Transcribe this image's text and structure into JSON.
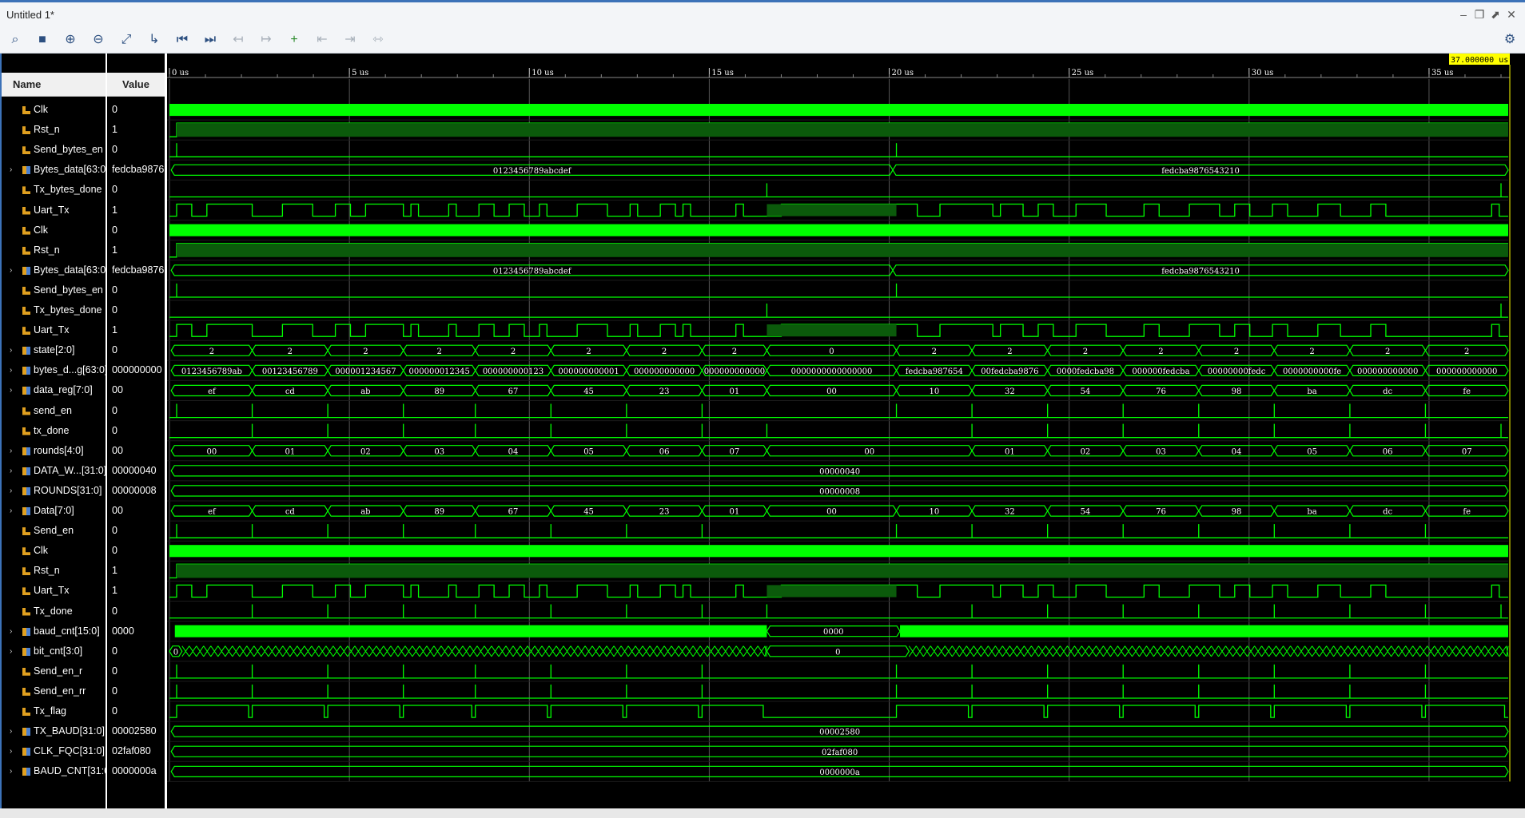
{
  "window": {
    "title": "Untitled 1*"
  },
  "toolbar": {
    "items": [
      "search-icon",
      "save-icon",
      "zoom-in-icon",
      "zoom-out-icon",
      "zoom-fit-icon",
      "go-to-cursor-icon",
      "go-to-start-icon",
      "go-to-end-icon",
      "previous-transition-icon",
      "next-transition-icon",
      "add-marker-icon",
      "previous-marker-icon",
      "next-marker-icon",
      "swap-cursors-icon",
      "settings-icon"
    ]
  },
  "columns": {
    "name": "Name",
    "value": "Value"
  },
  "cursor": {
    "label": "37.000000 us",
    "time": 37
  },
  "timeline": {
    "end": 37.2,
    "ticks": [
      {
        "t": 0,
        "label": "0 us"
      },
      {
        "t": 5,
        "label": "5 us"
      },
      {
        "t": 10,
        "label": "10 us"
      },
      {
        "t": 15,
        "label": "15 us"
      },
      {
        "t": 20,
        "label": "20 us"
      },
      {
        "t": 25,
        "label": "25 us"
      },
      {
        "t": 30,
        "label": "30 us"
      },
      {
        "t": 35,
        "label": "35 us"
      }
    ]
  },
  "colors": {
    "wave": "#00ff00",
    "background": "#000000",
    "cursor_label": "#ffff00",
    "grid": "#444444"
  },
  "signals": [
    {
      "name": "Clk",
      "value": "0",
      "kind": "clock",
      "expandable": false
    },
    {
      "name": "Rst_n",
      "value": "1",
      "kind": "high",
      "expandable": false
    },
    {
      "name": "Send_bytes_en",
      "value": "0",
      "kind": "pulses",
      "expandable": false
    },
    {
      "name": "Bytes_data[63:0]",
      "value": "fedcba9876",
      "kind": "bus",
      "expandable": true,
      "segs": [
        "0123456789abcdef",
        "fedcba9876543210"
      ]
    },
    {
      "name": "Tx_bytes_done",
      "value": "0",
      "kind": "pulse_done",
      "expandable": false
    },
    {
      "name": "Uart_Tx",
      "value": "1",
      "kind": "uart",
      "expandable": false
    },
    {
      "name": "Clk",
      "value": "0",
      "kind": "clock",
      "expandable": false
    },
    {
      "name": "Rst_n",
      "value": "1",
      "kind": "high",
      "expandable": false
    },
    {
      "name": "Bytes_data[63:0]",
      "value": "fedcba9876",
      "kind": "bus",
      "expandable": true,
      "segs": [
        "0123456789abcdef",
        "fedcba9876543210"
      ]
    },
    {
      "name": "Send_bytes_en",
      "value": "0",
      "kind": "pulses",
      "expandable": false
    },
    {
      "name": "Tx_bytes_done",
      "value": "0",
      "kind": "pulse_done",
      "expandable": false
    },
    {
      "name": "Uart_Tx",
      "value": "1",
      "kind": "uart",
      "expandable": false
    },
    {
      "name": "state[2:0]",
      "value": "0",
      "kind": "bus16",
      "expandable": true,
      "segs": [
        "2",
        "2",
        "2",
        "2",
        "2",
        "2",
        "2",
        "2",
        "0",
        "2",
        "2",
        "2",
        "2",
        "2",
        "2",
        "2",
        "2"
      ]
    },
    {
      "name": "bytes_d...g[63:0]",
      "value": "000000000",
      "kind": "bus16",
      "expandable": true,
      "segs": [
        "0123456789ab",
        "00123456789",
        "000001234567",
        "000000012345",
        "000000000123",
        "000000000001",
        "000000000000",
        "000000000000",
        "0000000000000000",
        "fedcba987654",
        "00fedcba9876",
        "0000fedcba98",
        "000000fedcba",
        "00000000fedc",
        "0000000000fe",
        "000000000000",
        "000000000000"
      ]
    },
    {
      "name": "data_reg[7:0]",
      "value": "00",
      "kind": "bus16",
      "expandable": true,
      "segs": [
        "ef",
        "cd",
        "ab",
        "89",
        "67",
        "45",
        "23",
        "01",
        "00",
        "10",
        "32",
        "54",
        "76",
        "98",
        "ba",
        "dc",
        "fe"
      ]
    },
    {
      "name": "send_en",
      "value": "0",
      "kind": "pulse_byte_start",
      "expandable": false
    },
    {
      "name": "tx_done",
      "value": "0",
      "kind": "pulse_byte_end",
      "expandable": false
    },
    {
      "name": "rounds[4:0]",
      "value": "00",
      "kind": "bus16",
      "expandable": true,
      "segs": [
        "00",
        "01",
        "02",
        "03",
        "04",
        "05",
        "06",
        "07",
        "00",
        "01",
        "02",
        "03",
        "04",
        "05",
        "06",
        "07"
      ]
    },
    {
      "name": "DATA_W...[31:0]",
      "value": "00000040",
      "kind": "const",
      "expandable": true,
      "segs": [
        "00000040"
      ]
    },
    {
      "name": "ROUNDS[31:0]",
      "value": "00000008",
      "kind": "const",
      "expandable": true,
      "segs": [
        "00000008"
      ]
    },
    {
      "name": "Data[7:0]",
      "value": "00",
      "kind": "bus16",
      "expandable": true,
      "segs": [
        "ef",
        "cd",
        "ab",
        "89",
        "67",
        "45",
        "23",
        "01",
        "00",
        "10",
        "32",
        "54",
        "76",
        "98",
        "ba",
        "dc",
        "fe"
      ]
    },
    {
      "name": "Send_en",
      "value": "0",
      "kind": "pulse_byte_start",
      "expandable": false
    },
    {
      "name": "Clk",
      "value": "0",
      "kind": "clock",
      "expandable": false
    },
    {
      "name": "Rst_n",
      "value": "1",
      "kind": "high",
      "expandable": false
    },
    {
      "name": "Uart_Tx",
      "value": "1",
      "kind": "uart",
      "expandable": false
    },
    {
      "name": "Tx_done",
      "value": "0",
      "kind": "pulse_byte_end",
      "expandable": false
    },
    {
      "name": "baud_cnt[15:0]",
      "value": "0000",
      "kind": "dense",
      "expandable": true,
      "segs": [
        "0000"
      ]
    },
    {
      "name": "bit_cnt[3:0]",
      "value": "0",
      "kind": "bitcnt",
      "expandable": true,
      "segs": [
        "0",
        "0"
      ]
    },
    {
      "name": "Send_en_r",
      "value": "0",
      "kind": "pulse_byte_start",
      "expandable": false
    },
    {
      "name": "Send_en_rr",
      "value": "0",
      "kind": "pulse_byte_start",
      "expandable": false
    },
    {
      "name": "Tx_flag",
      "value": "0",
      "kind": "txflag",
      "expandable": false
    },
    {
      "name": "TX_BAUD[31:0]",
      "value": "00002580",
      "kind": "const",
      "expandable": true,
      "segs": [
        "00002580"
      ]
    },
    {
      "name": "CLK_FQC[31:0]",
      "value": "02faf080",
      "kind": "const",
      "expandable": true,
      "segs": [
        "02faf080"
      ]
    },
    {
      "name": "BAUD_CNT[31:0]",
      "value": "0000000a",
      "kind": "const",
      "expandable": true,
      "segs": [
        "0000000a"
      ]
    }
  ]
}
